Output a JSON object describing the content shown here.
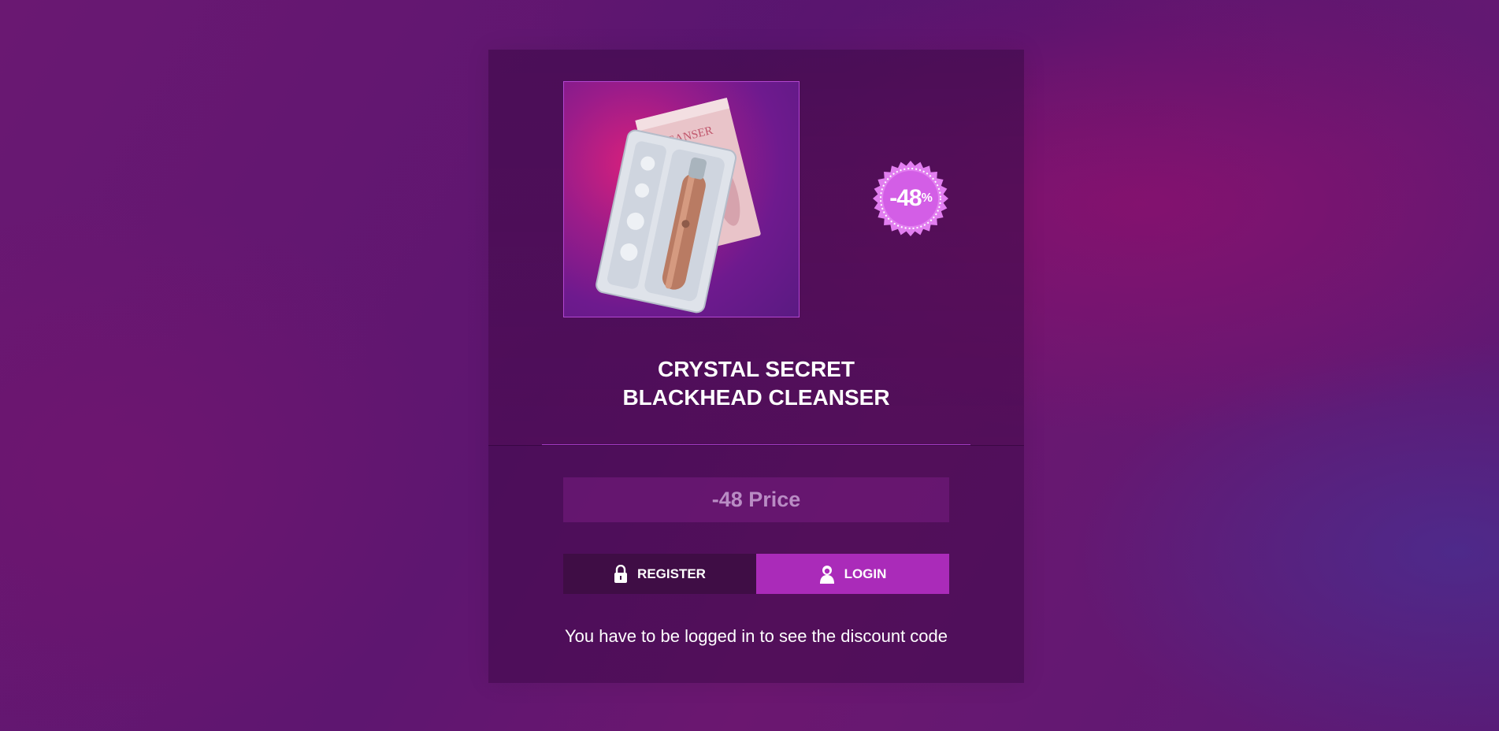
{
  "product": {
    "title_line1": "CRYSTAL SECRET",
    "title_line2": "BLACKHEAD CLEANSER",
    "image_name": "product-image",
    "box_text": "CLEANSER"
  },
  "badge": {
    "value": "-48",
    "suffix": "%",
    "color": "#e27ef0"
  },
  "price": {
    "label": "-48 Price"
  },
  "actions": {
    "register_label": "REGISTER",
    "register_icon": "lock-icon",
    "login_label": "LOGIN",
    "login_icon": "user-icon"
  },
  "note": {
    "text": "You have to be logged in to see the discount code"
  },
  "colors": {
    "accent": "#aa2bb9",
    "register_bg": "#3f0d45",
    "divider": "#a43bc4"
  }
}
